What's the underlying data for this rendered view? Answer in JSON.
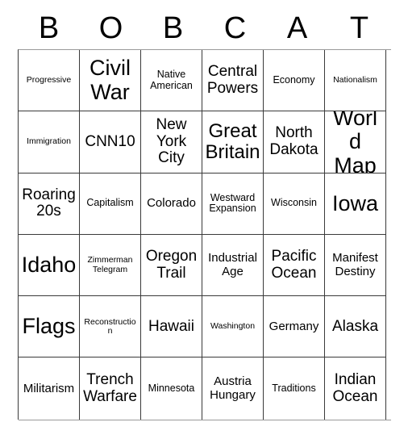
{
  "card": {
    "header_letters": [
      "B",
      "O",
      "B",
      "C",
      "A",
      "T"
    ],
    "rows": [
      [
        {
          "text": "Progressive",
          "size": "xs"
        },
        {
          "text": "Civil War",
          "size": "xxl"
        },
        {
          "text": "Native American",
          "size": "s"
        },
        {
          "text": "Central Powers",
          "size": "l"
        },
        {
          "text": "Economy",
          "size": "s"
        },
        {
          "text": "Nationalism",
          "size": "xs"
        }
      ],
      [
        {
          "text": "Immigration",
          "size": "xs"
        },
        {
          "text": "CNN10",
          "size": "l"
        },
        {
          "text": "New York City",
          "size": "l"
        },
        {
          "text": "Great Britain",
          "size": "xl"
        },
        {
          "text": "North Dakota",
          "size": "l"
        },
        {
          "text": "World Map",
          "size": "xxl"
        }
      ],
      [
        {
          "text": "Roaring 20s",
          "size": "l"
        },
        {
          "text": "Capitalism",
          "size": "s"
        },
        {
          "text": "Colorado",
          "size": "m"
        },
        {
          "text": "Westward Expansion",
          "size": "s"
        },
        {
          "text": "Wisconsin",
          "size": "s"
        },
        {
          "text": "Iowa",
          "size": "xxl"
        }
      ],
      [
        {
          "text": "Idaho",
          "size": "xxl"
        },
        {
          "text": "Zimmerman Telegram",
          "size": "xs"
        },
        {
          "text": "Oregon Trail",
          "size": "l"
        },
        {
          "text": "Industrial Age",
          "size": "m"
        },
        {
          "text": "Pacific Ocean",
          "size": "l"
        },
        {
          "text": "Manifest Destiny",
          "size": "m"
        }
      ],
      [
        {
          "text": "Flags",
          "size": "xxl"
        },
        {
          "text": "Reconstruction",
          "size": "xs"
        },
        {
          "text": "Hawaii",
          "size": "l"
        },
        {
          "text": "Washington",
          "size": "xs"
        },
        {
          "text": "Germany",
          "size": "m"
        },
        {
          "text": "Alaska",
          "size": "l"
        }
      ],
      [
        {
          "text": "Militarism",
          "size": "m"
        },
        {
          "text": "Trench Warfare",
          "size": "l"
        },
        {
          "text": "Minnesota",
          "size": "s"
        },
        {
          "text": "Austria Hungary",
          "size": "m"
        },
        {
          "text": "Traditions",
          "size": "s"
        },
        {
          "text": "Indian Ocean",
          "size": "l"
        }
      ]
    ]
  }
}
